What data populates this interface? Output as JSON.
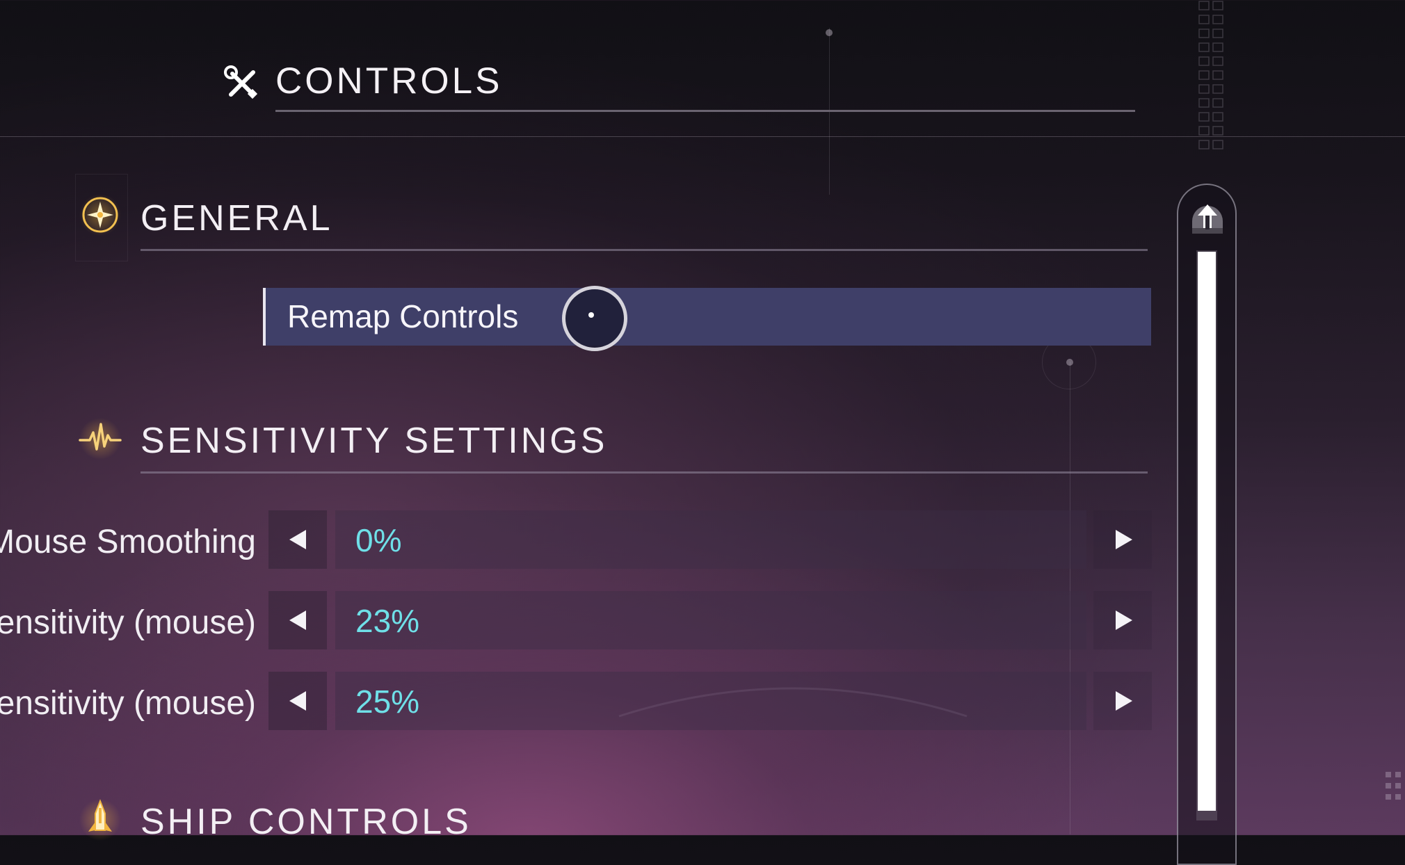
{
  "header": {
    "title": "CONTROLS",
    "icon": "wrench-screwdriver-icon"
  },
  "sections": {
    "general": {
      "title": "GENERAL",
      "icon": "compass-icon",
      "remap_label": "Remap Controls"
    },
    "sensitivity": {
      "title": "SENSITIVITY SETTINGS",
      "icon": "pulse-icon",
      "rows": [
        {
          "label": "Mouse Smoothing",
          "value": "0%"
        },
        {
          "label": "Sensitivity (mouse)",
          "value": "23%"
        },
        {
          "label": "Sensitivity (mouse)",
          "value": "25%"
        }
      ]
    },
    "ship": {
      "title": "SHIP CONTROLS",
      "icon": "rocket-icon"
    }
  },
  "scrollbar": {
    "icon": "scroll-top-icon"
  },
  "colors": {
    "accent_gold": "#f2b640",
    "value_cyan": "#6fe0e8",
    "highlight_row": "#3f3f68"
  }
}
